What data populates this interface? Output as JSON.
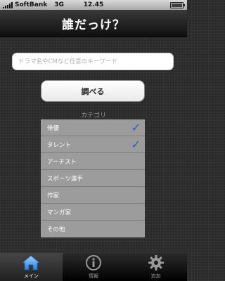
{
  "status_bar": {
    "carrier": "SoftBank",
    "network": "3G",
    "time": "12.45"
  },
  "nav": {
    "title": "誰だっけ？"
  },
  "search": {
    "placeholder": "ドラマ名やCMなど任意のキーワード",
    "value": ""
  },
  "search_button": {
    "label": "調べる"
  },
  "category_section": {
    "label": "カテゴリ",
    "items": [
      {
        "label": "俳優",
        "checked": true
      },
      {
        "label": "タレント",
        "checked": true
      },
      {
        "label": "アーチスト",
        "checked": false
      },
      {
        "label": "スポーツ選手",
        "checked": false
      },
      {
        "label": "作家",
        "checked": false
      },
      {
        "label": "マンガ家",
        "checked": false
      },
      {
        "label": "その他",
        "checked": false
      }
    ],
    "check_glyph": "✓"
  },
  "tab_bar": {
    "tabs": [
      {
        "label": "メイン",
        "icon": "home-icon",
        "active": true
      },
      {
        "label": "情報",
        "icon": "info-icon",
        "active": false
      },
      {
        "label": "追加",
        "icon": "gear-icon",
        "active": false
      }
    ]
  },
  "colors": {
    "check": "#2f5fb3",
    "accent_home": "#3b8ee6"
  }
}
